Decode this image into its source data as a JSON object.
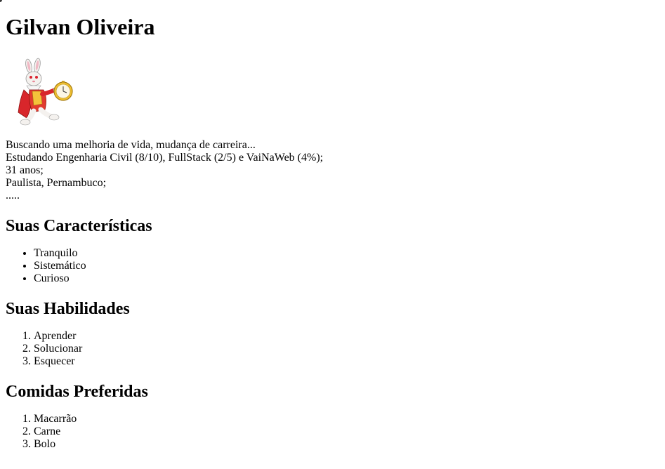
{
  "profile": {
    "name": "Gilvan Oliveira",
    "avatar_icon": "white-rabbit-with-pocket-watch",
    "bio_lines": [
      "Buscando uma melhoria de vida, mudança de carreira...",
      "Estudando Engenharia Civil (8/10), FullStack (2/5) e VaiNaWeb (4%);",
      "31 anos;",
      "Paulista, Pernambuco;",
      "....."
    ]
  },
  "sections": {
    "characteristics": {
      "title": "Suas Características",
      "items": [
        "Tranquilo",
        "Sistemático",
        "Curioso"
      ]
    },
    "skills": {
      "title": "Suas Habilidades",
      "items": [
        "Aprender",
        "Solucionar",
        "Esquecer"
      ]
    },
    "foods": {
      "title": "Comidas Preferidas",
      "items": [
        "Macarrão",
        "Carne",
        "Bolo"
      ]
    }
  },
  "colors": {
    "background": "#ffffff",
    "text": "#000000"
  }
}
